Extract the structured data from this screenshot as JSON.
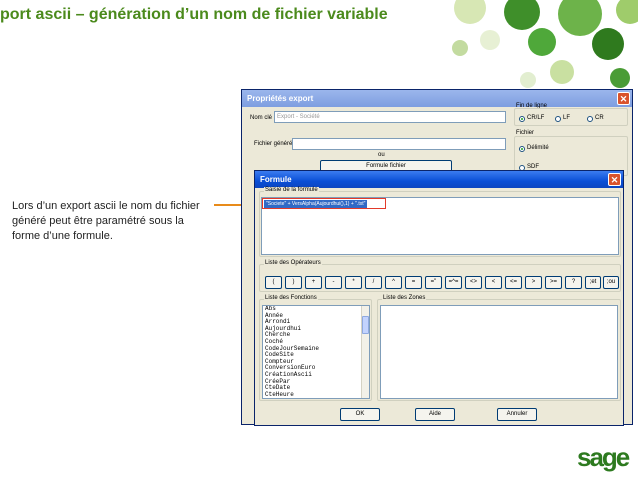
{
  "slide": {
    "title": "port ascii – génération d’un nom de fichier variable",
    "callout": "Lors d’un export ascii le nom du fichier généré peut être paramétré sous la forme d’une formule.",
    "logo": "sage",
    "colors": {
      "title": "#4b8a1c",
      "callout_line": "#e88b1a",
      "logo": "#2d7a1f"
    }
  },
  "export_window": {
    "title": "Propriétés export",
    "nom_cle_label": "Nom clé",
    "nom_cle_value": "Export - Société",
    "fichier_genere_label": "Fichier généré",
    "ou_label": "ou",
    "formule_fichier_button": "Formule fichier",
    "fin_de_ligne": {
      "label": "Fin de ligne",
      "options": [
        "CR/LF",
        "LF",
        "CR"
      ],
      "selected": "CR/LF"
    },
    "fichier": {
      "label": "Fichier",
      "options": [
        "Délimité",
        "SDF"
      ],
      "selected": "Délimité"
    }
  },
  "formula_dialog": {
    "title": "Formule",
    "saisie_label": "Saisie de la formule",
    "formula_value": "\"Societe\" + VersAlpha(Aujourdhui(),1) + \".txt\"",
    "operators_label": "Liste des Opérateurs",
    "operators": [
      "(",
      ")",
      "+",
      "-",
      "*",
      "/",
      "^",
      "=",
      "=\"",
      "=^=",
      "<>",
      "<",
      "<=",
      ">",
      ">=",
      "?",
      ";et",
      ";ou"
    ],
    "functions_label": "Liste des Fonctions",
    "functions": [
      "Abs",
      "Année",
      "Arrondi",
      "Aujourdhui",
      "Cherche",
      "Coché",
      "CodeJourSemaine",
      "CodeSite",
      "Compteur",
      "ConversionEuro",
      "CréationAscii",
      "CréePar",
      "CteDate",
      "CteHeure"
    ],
    "zones_label": "Liste des Zones",
    "buttons": {
      "ok": "OK",
      "aide": "Aide",
      "annuler": "Annuler"
    }
  }
}
